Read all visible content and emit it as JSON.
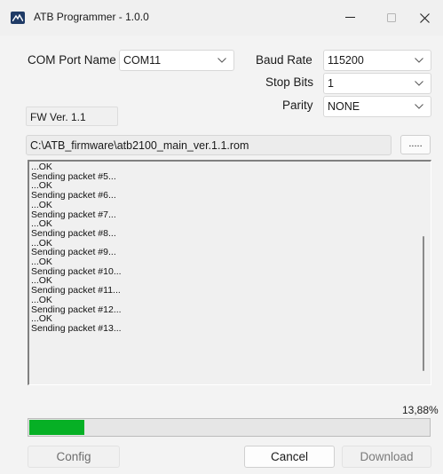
{
  "window": {
    "title": "ATB Programmer - 1.0.0",
    "icons": {
      "app": "atb-logo-icon",
      "minimize": "minimize-icon",
      "maximize": "maximize-icon",
      "close": "close-icon"
    }
  },
  "settings": {
    "com_port_label": "COM Port Name",
    "com_port_value": "COM11",
    "baud_rate_label": "Baud Rate",
    "baud_rate_value": "115200",
    "stop_bits_label": "Stop Bits",
    "stop_bits_value": "1",
    "parity_label": "Parity",
    "parity_value": "NONE"
  },
  "firmware": {
    "version": "FW Ver. 1.1",
    "path": "C:\\ATB_firmware\\atb2100_main_ver.1.1.rom",
    "browse_label": "....."
  },
  "log": {
    "lines": [
      "...OK",
      "Sending packet #5...",
      "...OK",
      "Sending packet #6...",
      "...OK",
      "Sending packet #7...",
      "...OK",
      "Sending packet #8...",
      "...OK",
      "Sending packet #9...",
      "...OK",
      "Sending packet #10...",
      "...OK",
      "Sending packet #11...",
      "...OK",
      "Sending packet #12...",
      "...OK",
      "Sending packet #13..."
    ]
  },
  "progress": {
    "percent_label": "13,88%",
    "fraction": 0.1388,
    "fill_color": "#06b025"
  },
  "buttons": {
    "config": "Config",
    "cancel": "Cancel",
    "download": "Download"
  }
}
